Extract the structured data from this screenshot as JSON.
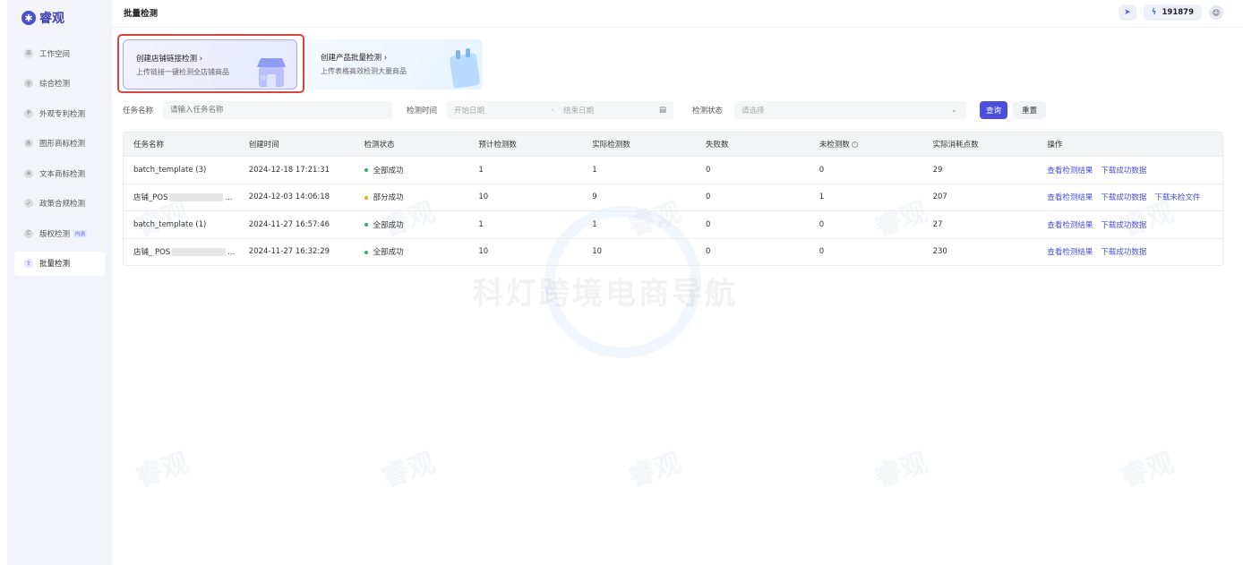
{
  "brand": {
    "name": "睿观"
  },
  "sidebar": {
    "items": [
      {
        "label": "工作空间",
        "icon": "workspace-icon",
        "glyph": "☰"
      },
      {
        "label": "综合检测",
        "icon": "search-icon",
        "glyph": "⚲"
      },
      {
        "label": "外观专利检测",
        "icon": "patent-icon",
        "glyph": "P"
      },
      {
        "label": "图形商标检测",
        "icon": "trademark-icon",
        "glyph": "R"
      },
      {
        "label": "文本商标检测",
        "icon": "text-icon",
        "glyph": "≡"
      },
      {
        "label": "政策合规检测",
        "icon": "check-icon",
        "glyph": "✓"
      },
      {
        "label": "版权检测",
        "badge": "内测",
        "icon": "copyright-icon",
        "glyph": "C"
      },
      {
        "label": "批量检测",
        "icon": "upload-icon",
        "glyph": "⇪",
        "active": true
      }
    ]
  },
  "header": {
    "title": "批量检测",
    "points": "191879",
    "icons": [
      "send-icon",
      "bolt-icon",
      "avatar-icon"
    ]
  },
  "cards": [
    {
      "title": "创建店铺链接检测 ›",
      "subtitle": "上传链接一键检测全店铺商品",
      "icon": "shop-icon"
    },
    {
      "title": "创建产品批量检测 ›",
      "subtitle": "上传表格高效检测大量商品",
      "icon": "clipboard-icon"
    }
  ],
  "filters": {
    "task_name_label": "任务名称",
    "task_name_placeholder": "请输入任务名称",
    "time_label": "检测时间",
    "start_placeholder": "开始日期",
    "range_sep": "-",
    "end_placeholder": "结束日期",
    "status_label": "检测状态",
    "status_placeholder": "请选择",
    "query_label": "查询",
    "reset_label": "重置"
  },
  "table": {
    "columns": [
      "任务名称",
      "创建时间",
      "检测状态",
      "预计检测数",
      "实际检测数",
      "失败数",
      "未检测数",
      "实际消耗点数",
      "操作"
    ],
    "rows": [
      {
        "name": "batch_template (3)",
        "name_suffix": "",
        "redacted": false,
        "created": "2024-12-18 17:21:31",
        "status": "全部成功",
        "status_color": "#2bb55a",
        "expected": "1",
        "actual": "1",
        "failed": "0",
        "pending": "0",
        "points": "29",
        "actions": [
          "查看检测结果",
          "下载成功数据"
        ]
      },
      {
        "name": "店铺_POS",
        "name_suffix": "...",
        "redacted": true,
        "created": "2024-12-03 14:06:18",
        "status": "部分成功",
        "status_color": "#f2a320",
        "expected": "10",
        "actual": "9",
        "failed": "0",
        "pending": "1",
        "points": "207",
        "actions": [
          "查看检测结果",
          "下载成功数据",
          "下载未检文件"
        ]
      },
      {
        "name": "batch_template (1)",
        "name_suffix": "",
        "redacted": false,
        "created": "2024-11-27 16:57:46",
        "status": "全部成功",
        "status_color": "#2bb55a",
        "expected": "1",
        "actual": "1",
        "failed": "0",
        "pending": "0",
        "points": "27",
        "actions": [
          "查看检测结果",
          "下载成功数据"
        ]
      },
      {
        "name": "店铺_ POS",
        "name_suffix": "...",
        "redacted": true,
        "created": "2024-11-27 16:32:29",
        "status": "全部成功",
        "status_color": "#2bb55a",
        "expected": "10",
        "actual": "10",
        "failed": "0",
        "pending": "0",
        "points": "230",
        "actions": [
          "查看检测结果",
          "下载成功数据"
        ]
      }
    ]
  },
  "watermarks": {
    "small": "睿观",
    "big": "科灯跨境电商导航"
  }
}
